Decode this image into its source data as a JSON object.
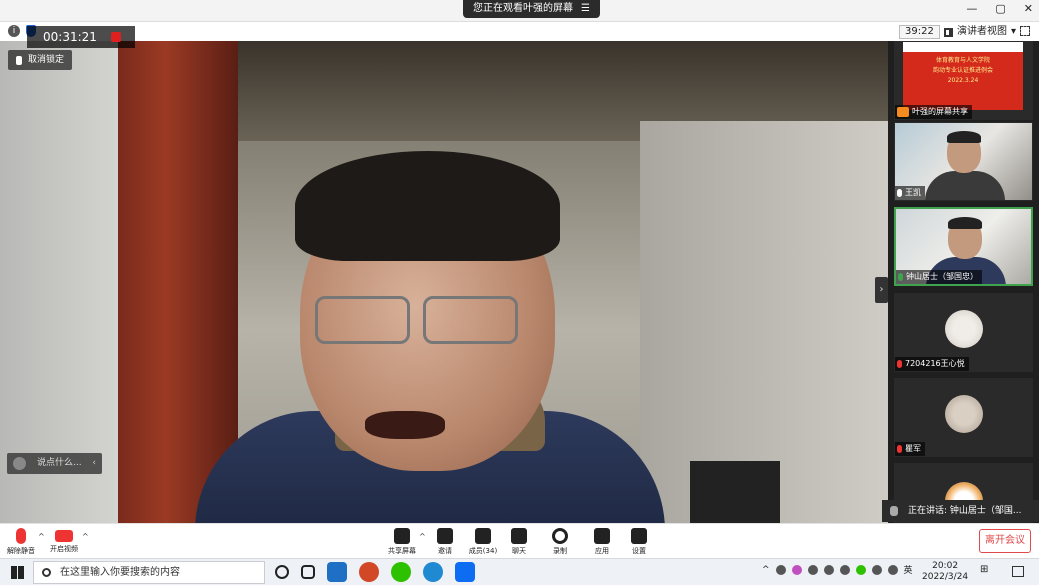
{
  "window": {
    "share_banner": "您正在观看叶强的屏幕",
    "share_menu_icon": "menu-icon",
    "controls": [
      "—",
      "▢",
      "✕"
    ]
  },
  "meeting": {
    "timer": "00:31:21",
    "clock": "39:22",
    "view_mode": "演讲者视图",
    "unlock_label": "取消锁定",
    "chat_placeholder": "说点什么...",
    "speaking": "正在讲话: 钟山居士（邹国..."
  },
  "participants": [
    {
      "name": "叶强的屏幕共享",
      "kind": "screen-share",
      "slide_text": [
        "体育教育与人文学院",
        "韵动专业认证推进例会",
        "2022.3.24"
      ]
    },
    {
      "name": "王凯",
      "kind": "video",
      "mic": "on"
    },
    {
      "name": "钟山居士（邹国忠）",
      "kind": "video",
      "mic": "active"
    },
    {
      "name": "7204216王心悦",
      "kind": "avatar",
      "mic": "muted"
    },
    {
      "name": "瞿军",
      "kind": "avatar",
      "mic": "muted"
    }
  ],
  "toolbar": {
    "unmute": "解除静音",
    "start_video": "开启视频",
    "share_screen": "共享屏幕",
    "invite": "邀请",
    "members": "成员(34)",
    "chat": "聊天",
    "record": "录制",
    "apps": "应用",
    "settings": "设置",
    "leave": "离开会议"
  },
  "taskbar": {
    "search_placeholder": "在这里输入你要搜索的内容",
    "ime": "英",
    "time": "20:02",
    "date": "2022/3/24"
  },
  "colors": {
    "accent_red": "#e04a4a",
    "active_green": "#3fa34d",
    "share_orange": "#f58a1f"
  }
}
